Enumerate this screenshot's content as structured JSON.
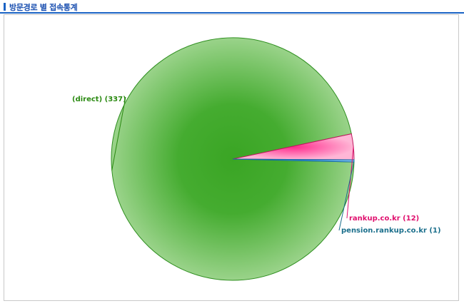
{
  "section": {
    "title": "방문경로 별 접속통계"
  },
  "colors": {
    "accent": "#1a63c4",
    "direct": "#3aaa2a",
    "rankup": "#ff4fa0",
    "pension": "#1f8fd6"
  },
  "chart_data": {
    "type": "pie",
    "slices": [
      {
        "label": "(direct) (337)",
        "value": 337,
        "color": "#3aaa2a",
        "text_color": "#2b8a12"
      },
      {
        "label": "rankup.co.kr (12)",
        "value": 12,
        "color": "#ff4fa0",
        "text_color": "#e0106e"
      },
      {
        "label": "pension.rankup.co.kr (1)",
        "value": 1,
        "color": "#1f8fd6",
        "text_color": "#1b6f8c"
      }
    ]
  }
}
